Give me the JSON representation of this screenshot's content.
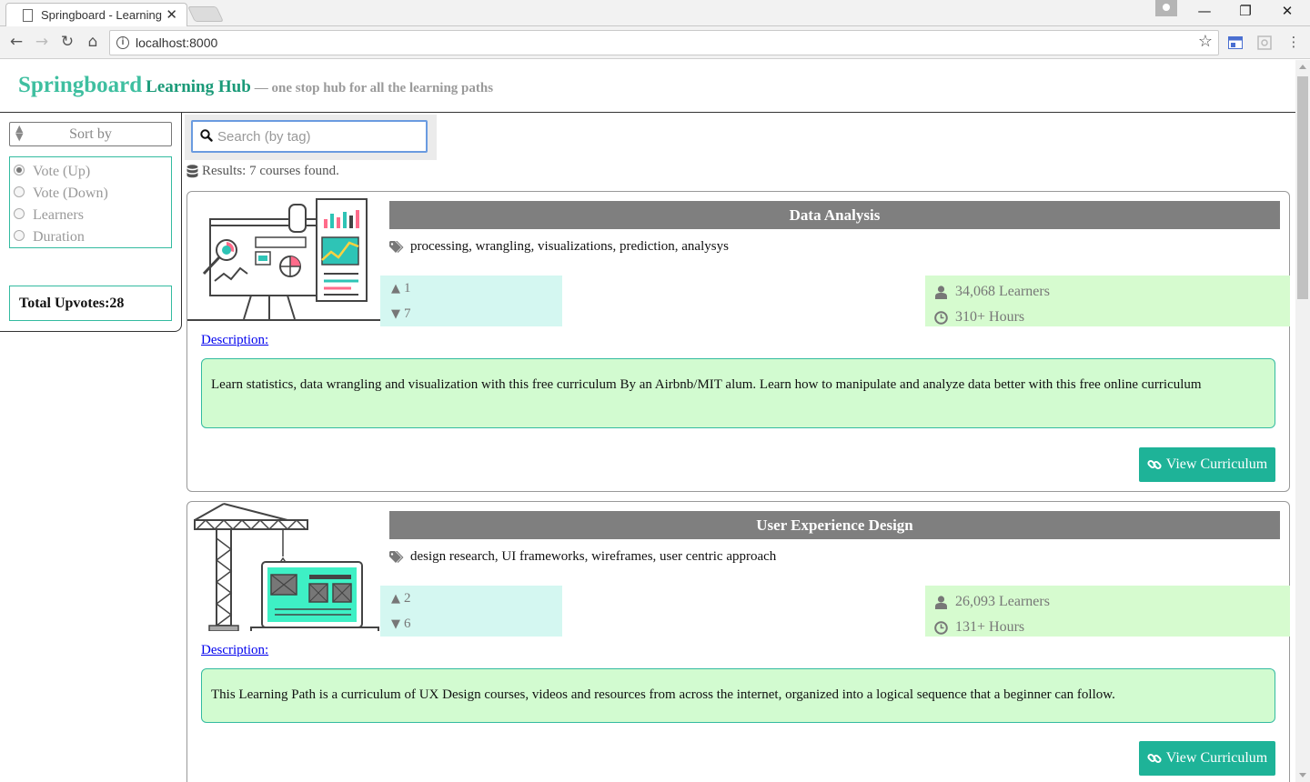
{
  "browser": {
    "tab_title": "Springboard - Learning Hub",
    "tab_close": "✕",
    "url": "localhost:8000",
    "window_buttons": {
      "minimize": "—",
      "restore": "❐",
      "close": "✕"
    }
  },
  "header": {
    "brand_primary": "Springboard",
    "brand_secondary": "Learning Hub",
    "tagline": "— one stop hub for all the learning paths"
  },
  "sidebar": {
    "sort_label": "Sort by",
    "options": [
      {
        "label": "Vote (Up)",
        "checked": true
      },
      {
        "label": "Vote (Down)",
        "checked": false
      },
      {
        "label": "Learners",
        "checked": false
      },
      {
        "label": "Duration",
        "checked": false
      }
    ],
    "total_upvotes": "Total Upvotes:28"
  },
  "search": {
    "placeholder": "Search (by tag)",
    "results_text": "Results: 7 courses found."
  },
  "courses": [
    {
      "title": "Data Analysis",
      "tags": "processing, wrangling, visualizations, prediction, analysys",
      "upvotes": "1",
      "downvotes": "7",
      "learners": "34,068 Learners",
      "duration": "310+ Hours",
      "description_label": "Description:",
      "description": "Learn statistics, data wrangling and visualization with this free curriculum By an Airbnb/MIT alum. Learn how to manipulate and analyze data better with this free online curriculum",
      "button_label": "View Curriculum"
    },
    {
      "title": "User Experience Design",
      "tags": "design research, UI frameworks, wireframes, user centric approach",
      "upvotes": "2",
      "downvotes": "6",
      "learners": "26,093 Learners",
      "duration": "131+ Hours",
      "description_label": "Description:",
      "description": "This Learning Path is a curriculum of UX Design courses, videos and resources from across the internet, organized into a logical sequence that a beginner can follow.",
      "button_label": "View Curriculum"
    }
  ],
  "colors": {
    "accent": "#1eb398",
    "brand": "#3fbfa0",
    "title_bar": "#7f7f7f",
    "vote_bg": "#d4f7f1",
    "stats_bg": "#d6fbcf",
    "desc_bg": "#d2fbd0"
  }
}
